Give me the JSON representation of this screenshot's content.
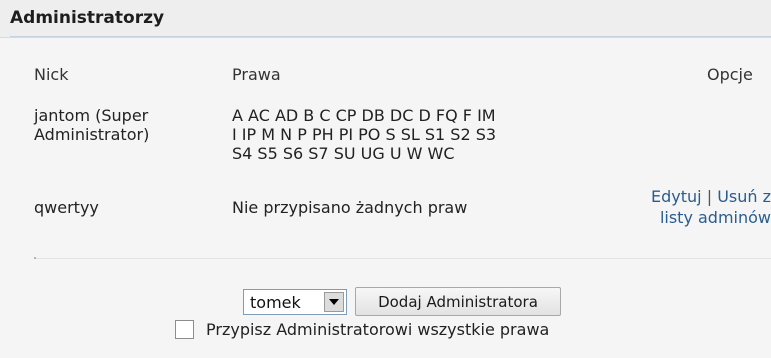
{
  "panel": {
    "title": "Administratorzy"
  },
  "table": {
    "headers": {
      "nick": "Nick",
      "prawa": "Prawa",
      "opcje": "Opcje"
    },
    "rows": [
      {
        "nick_line1": "jantom (Super",
        "nick_line2": "Administrator)",
        "prawa_line1": "A AC AD B C CP DB DC D FQ F IM",
        "prawa_line2": "I IP M N P PH PI PO S SL S1 S2 S3",
        "prawa_line3": "S4 S5 S6 S7 SU UG U W WC"
      },
      {
        "nick": "qwertyy",
        "prawa": "Nie przypisano żadnych praw",
        "options": {
          "edit_label": "Edytuj",
          "separator": "|",
          "remove_line1": "Usuń z",
          "remove_line2": "listy adminów"
        }
      }
    ]
  },
  "add_admin": {
    "select_value": "tomek",
    "button_label": "Dodaj Administratora",
    "checkbox_label": "Przypisz Administratorowi wszystkie prawa",
    "checkbox_checked": false
  },
  "colors": {
    "link": "#2a5d8f",
    "panel_background": "#f5f5f5",
    "header_background": "#eeeeee"
  }
}
